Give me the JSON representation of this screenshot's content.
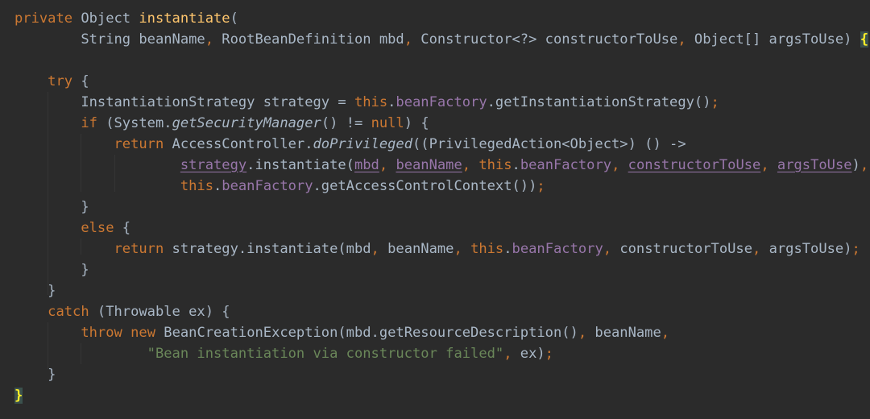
{
  "editor": {
    "lines": [
      [
        {
          "t": "private",
          "c": "kw",
          "n": "keyword-token"
        },
        {
          "t": " Object ",
          "n": "type-token"
        },
        {
          "t": "instantiate",
          "c": "fn",
          "n": "method-name-token"
        },
        {
          "t": "(",
          "n": "paren-token"
        }
      ],
      [
        {
          "t": "        String beanName",
          "n": "param-token"
        },
        {
          "t": ",",
          "c": "kw",
          "n": "comma-token"
        },
        {
          "t": " RootBeanDefinition mbd",
          "n": "param-token"
        },
        {
          "t": ",",
          "c": "kw",
          "n": "comma-token"
        },
        {
          "t": " Constructor<?> constructorToUse",
          "n": "param-token"
        },
        {
          "t": ",",
          "c": "kw",
          "n": "comma-token"
        },
        {
          "t": " Object[] argsToUse) ",
          "n": "param-token"
        },
        {
          "t": "{",
          "c": "brace-match",
          "n": "matched-brace-token"
        }
      ],
      [],
      [
        {
          "t": "    ",
          "n": "indent"
        },
        {
          "t": "try",
          "c": "kw",
          "n": "keyword-token"
        },
        {
          "t": " {",
          "n": "brace-token"
        }
      ],
      [
        {
          "t": "        InstantiationStrategy strategy = ",
          "n": "code-token"
        },
        {
          "t": "this",
          "c": "kw",
          "n": "keyword-token"
        },
        {
          "t": ".",
          "n": "dot-token"
        },
        {
          "t": "beanFactory",
          "c": "fld",
          "n": "field-token"
        },
        {
          "t": ".getInstantiationStrategy()",
          "n": "call-token"
        },
        {
          "t": ";",
          "c": "kw",
          "n": "semicolon-token"
        }
      ],
      [
        {
          "t": "        ",
          "n": "indent"
        },
        {
          "t": "if",
          "c": "kw",
          "n": "keyword-token"
        },
        {
          "t": " (System.",
          "n": "code-token"
        },
        {
          "t": "getSecurityManager",
          "c": "it",
          "n": "static-call-token"
        },
        {
          "t": "() != ",
          "n": "code-token"
        },
        {
          "t": "null",
          "c": "kw",
          "n": "keyword-token"
        },
        {
          "t": ") {",
          "n": "code-token"
        }
      ],
      [
        {
          "t": "            ",
          "n": "indent"
        },
        {
          "t": "return",
          "c": "kw",
          "n": "keyword-token"
        },
        {
          "t": " AccessController.",
          "n": "code-token"
        },
        {
          "t": "doPrivileged",
          "c": "it",
          "n": "static-call-token"
        },
        {
          "t": "((PrivilegedAction<Object>) () ->",
          "n": "code-token"
        }
      ],
      [
        {
          "t": "                    ",
          "n": "indent"
        },
        {
          "t": "strategy",
          "c": "fld ul",
          "n": "captured-var-token"
        },
        {
          "t": ".instantiate(",
          "n": "call-token"
        },
        {
          "t": "mbd",
          "c": "fld ul",
          "n": "captured-var-token"
        },
        {
          "t": ",",
          "c": "kw",
          "n": "comma-token"
        },
        {
          "t": " ",
          "n": "space"
        },
        {
          "t": "beanName",
          "c": "fld ul",
          "n": "captured-var-token"
        },
        {
          "t": ",",
          "c": "kw",
          "n": "comma-token"
        },
        {
          "t": " ",
          "n": "space"
        },
        {
          "t": "this",
          "c": "kw",
          "n": "keyword-token"
        },
        {
          "t": ".",
          "n": "dot-token"
        },
        {
          "t": "beanFactory",
          "c": "fld",
          "n": "field-token"
        },
        {
          "t": ",",
          "c": "kw",
          "n": "comma-token"
        },
        {
          "t": " ",
          "n": "space"
        },
        {
          "t": "constructorToUse",
          "c": "fld ul",
          "n": "captured-var-token"
        },
        {
          "t": ",",
          "c": "kw",
          "n": "comma-token"
        },
        {
          "t": " ",
          "n": "space"
        },
        {
          "t": "argsToUse",
          "c": "fld ul",
          "n": "captured-var-token"
        },
        {
          "t": ")",
          "n": "paren-token"
        },
        {
          "t": ",",
          "c": "kw",
          "n": "comma-token"
        }
      ],
      [
        {
          "t": "                    ",
          "n": "indent"
        },
        {
          "t": "this",
          "c": "kw",
          "n": "keyword-token"
        },
        {
          "t": ".",
          "n": "dot-token"
        },
        {
          "t": "beanFactory",
          "c": "fld",
          "n": "field-token"
        },
        {
          "t": ".getAccessControlContext())",
          "n": "call-token"
        },
        {
          "t": ";",
          "c": "kw",
          "n": "semicolon-token"
        }
      ],
      [
        {
          "t": "        }",
          "n": "brace-token"
        }
      ],
      [
        {
          "t": "        ",
          "n": "indent"
        },
        {
          "t": "else",
          "c": "kw",
          "n": "keyword-token"
        },
        {
          "t": " {",
          "n": "brace-token"
        }
      ],
      [
        {
          "t": "            ",
          "n": "indent"
        },
        {
          "t": "return",
          "c": "kw",
          "n": "keyword-token"
        },
        {
          "t": " strategy.instantiate(mbd",
          "n": "call-token"
        },
        {
          "t": ",",
          "c": "kw",
          "n": "comma-token"
        },
        {
          "t": " beanName",
          "n": "code-token"
        },
        {
          "t": ",",
          "c": "kw",
          "n": "comma-token"
        },
        {
          "t": " ",
          "n": "space"
        },
        {
          "t": "this",
          "c": "kw",
          "n": "keyword-token"
        },
        {
          "t": ".",
          "n": "dot-token"
        },
        {
          "t": "beanFactory",
          "c": "fld",
          "n": "field-token"
        },
        {
          "t": ",",
          "c": "kw",
          "n": "comma-token"
        },
        {
          "t": " constructorToUse",
          "n": "code-token"
        },
        {
          "t": ",",
          "c": "kw",
          "n": "comma-token"
        },
        {
          "t": " argsToUse)",
          "n": "code-token"
        },
        {
          "t": ";",
          "c": "kw",
          "n": "semicolon-token"
        }
      ],
      [
        {
          "t": "        }",
          "n": "brace-token"
        }
      ],
      [
        {
          "t": "    }",
          "n": "brace-token"
        }
      ],
      [
        {
          "t": "    ",
          "n": "indent"
        },
        {
          "t": "catch",
          "c": "kw",
          "n": "keyword-token"
        },
        {
          "t": " (Throwable ex) {",
          "n": "code-token"
        }
      ],
      [
        {
          "t": "        ",
          "n": "indent"
        },
        {
          "t": "throw",
          "c": "kw",
          "n": "keyword-token"
        },
        {
          "t": " ",
          "n": "space"
        },
        {
          "t": "new",
          "c": "kw",
          "n": "keyword-token"
        },
        {
          "t": " BeanCreationException(mbd.getResourceDescription()",
          "n": "call-token"
        },
        {
          "t": ",",
          "c": "kw",
          "n": "comma-token"
        },
        {
          "t": " beanName",
          "n": "code-token"
        },
        {
          "t": ",",
          "c": "kw",
          "n": "comma-token"
        }
      ],
      [
        {
          "t": "                ",
          "n": "indent"
        },
        {
          "t": "\"Bean instantiation via constructor failed\"",
          "c": "str",
          "n": "string-literal-token"
        },
        {
          "t": ",",
          "c": "kw",
          "n": "comma-token"
        },
        {
          "t": " ex)",
          "n": "code-token"
        },
        {
          "t": ";",
          "c": "kw",
          "n": "semicolon-token"
        }
      ],
      [
        {
          "t": "    }",
          "n": "brace-token"
        }
      ],
      [
        {
          "t": "}",
          "c": "brace-match",
          "n": "matched-brace-token"
        }
      ]
    ],
    "caret_line_index": 19
  }
}
